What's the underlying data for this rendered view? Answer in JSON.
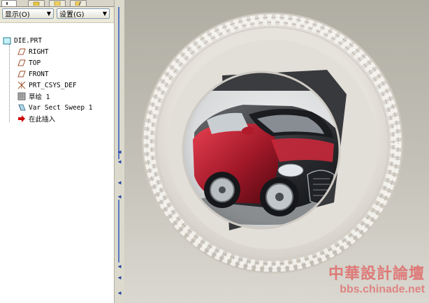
{
  "model_tree": {
    "toolbar": {
      "show_menu": "显示(O)",
      "settings_menu": "设置(G)"
    },
    "items": [
      {
        "label": "DIE.PRT",
        "icon": "part-icon"
      },
      {
        "label": "RIGHT",
        "icon": "datum-plane-icon"
      },
      {
        "label": "TOP",
        "icon": "datum-plane-icon"
      },
      {
        "label": "FRONT",
        "icon": "datum-plane-icon"
      },
      {
        "label": "PRT_CSYS_DEF",
        "icon": "coordinate-system-icon"
      },
      {
        "label": "草绘 1",
        "icon": "sketch-icon"
      },
      {
        "label": "Var Sect Sweep 1",
        "icon": "sweep-icon"
      },
      {
        "label": "在此插入",
        "icon": "insert-here-arrow-icon"
      }
    ]
  },
  "watermark": {
    "title": "中華設計論壇",
    "url": "bbs.chinade.net"
  },
  "colors": {
    "accent": "#cc2233",
    "plane_icon": "#a0522d",
    "insert_arrow": "#cc0000"
  }
}
